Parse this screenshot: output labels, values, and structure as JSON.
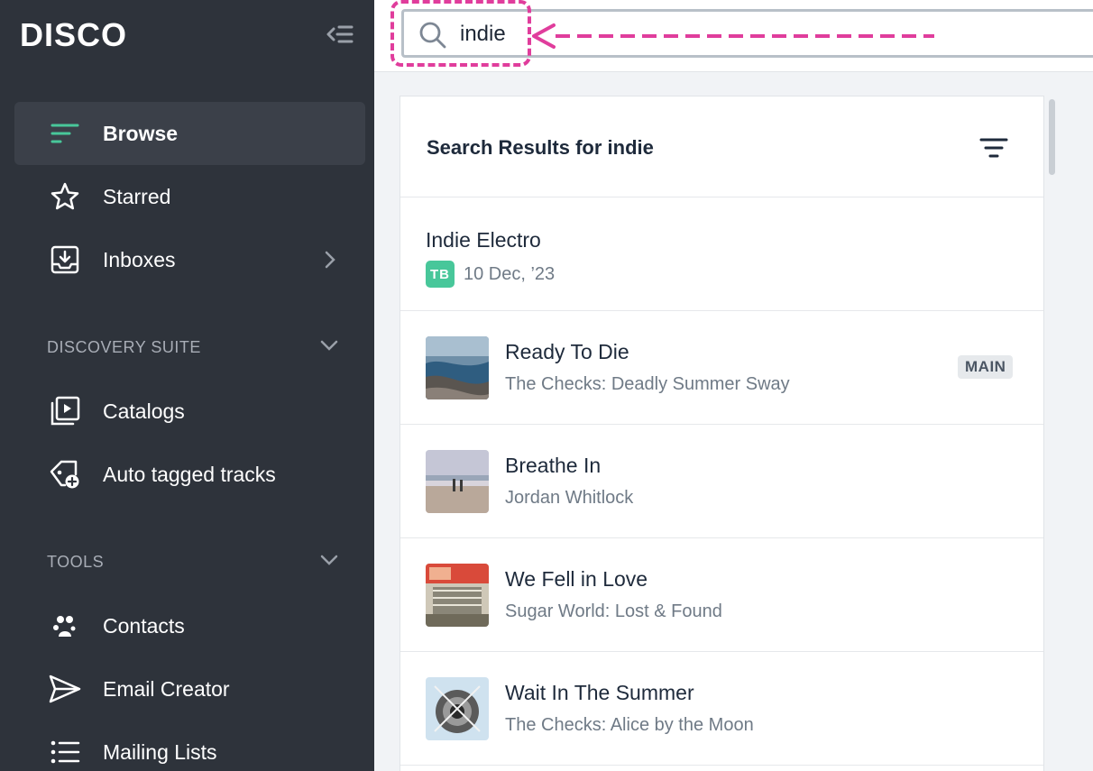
{
  "sidebar": {
    "logo": "DISCO",
    "nav": [
      {
        "label": "Browse",
        "icon": "browse-lines-icon",
        "active": true
      },
      {
        "label": "Starred",
        "icon": "star-icon"
      },
      {
        "label": "Inboxes",
        "icon": "inbox-icon"
      }
    ],
    "discovery_suite": {
      "heading": "DISCOVERY SUITE",
      "items": [
        {
          "label": "Catalogs",
          "icon": "catalogs-icon"
        },
        {
          "label": "Auto tagged tracks",
          "icon": "auto-tag-icon"
        }
      ]
    },
    "tools": {
      "heading": "TOOLS",
      "items": [
        {
          "label": "Contacts",
          "icon": "contacts-icon"
        },
        {
          "label": "Email Creator",
          "icon": "send-icon"
        },
        {
          "label": "Mailing Lists",
          "icon": "list-icon"
        }
      ]
    }
  },
  "search": {
    "value": "indie",
    "placeholder": ""
  },
  "results": {
    "title": "Search Results for indie",
    "playlist": {
      "title": "Indie Electro",
      "owner_initials": "TB",
      "date": "10 Dec, ’23"
    },
    "tracks": [
      {
        "title": "Ready To Die",
        "subtitle": "The Checks: Deadly Summer Sway",
        "badge": "MAIN"
      },
      {
        "title": "Breathe In",
        "subtitle": "Jordan Whitlock"
      },
      {
        "title": "We Fell in Love",
        "subtitle": "Sugar World: Lost & Found"
      },
      {
        "title": "Wait In The Summer",
        "subtitle": "The Checks: Alice by the Moon"
      }
    ]
  },
  "colors": {
    "sidebar_bg": "#2e333b",
    "accent_green": "#48c79a",
    "annotation_pink": "#e03d9c"
  }
}
